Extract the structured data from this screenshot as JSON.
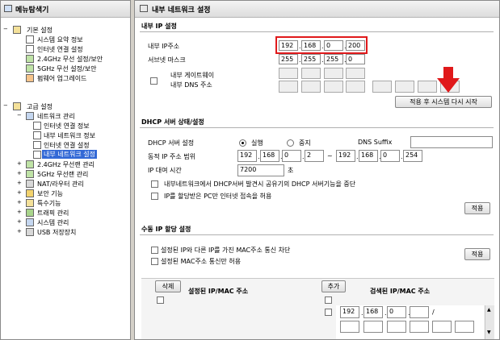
{
  "sidebar": {
    "title": "메뉴탐색기",
    "basic_group": "기본 설정",
    "basic_items": [
      "시스템 요약 정보",
      "인터넷 연결 설정",
      "2.4GHz 무선 설정/보안",
      "5GHz 무선 설정/보안",
      "펌웨어 업그레이드"
    ],
    "advanced_group": "고급 설정",
    "network_mgmt": "네트워크 관리",
    "network_items": [
      "인터넷 연결 정보",
      "내부 네트워크 정보",
      "인터넷 연결 설정",
      "내부 네트워크 설정"
    ],
    "advanced_items": [
      "2.4GHz 무선랜 관리",
      "5GHz 무선랜 관리",
      "NAT/라우터 관리",
      "보안 기능",
      "특수기능",
      "트래픽 관리",
      "시스템 관리",
      "USB 저장장치"
    ]
  },
  "main": {
    "title": "내부 네트워크 설정",
    "internal_ip_section": "내부 IP 설정",
    "internal_ip_label": "내부 IP주소",
    "internal_ip": [
      "192",
      "168",
      "0",
      "200"
    ],
    "subnet_label": "서브넷 마스크",
    "subnet": [
      "255",
      "255",
      "255",
      "0"
    ],
    "gateway_label": "내부 게이트웨이",
    "dns_label": "내부 DNS 주소",
    "apply_restart_button": "적용 후 시스템 다시 시작",
    "dhcp_section": "DHCP 서버 상태/설정",
    "dhcp_server_label": "DHCP 서버 설정",
    "dhcp_run_label": "실행",
    "dhcp_stop_label": "중지",
    "dns_suffix_label": "DNS Suffix",
    "dynamic_ip_range_label": "동적 IP 주소 범위",
    "range_start": [
      "192",
      "168",
      "0",
      "2"
    ],
    "range_tilde": "~",
    "range_end": [
      "192",
      "168",
      "0",
      "254"
    ],
    "lease_time_label": "IP 대여 시간",
    "lease_time_value": "7200",
    "lease_unit": "초",
    "dhcp_option1": "내부네트워크에서 DHCP서버 발견시 공유기의 DHCP 서버기능을 중단",
    "dhcp_option2": "IP를 할당받은 PC만 인터넷 접속을 허용",
    "apply_button": "적용",
    "manual_section": "수동 IP 할당 설정",
    "manual_option1": "설정된 IP와 다른 IP를 가진 MAC주소 통신 차단",
    "manual_option2": "설정된 MAC주소 통신만 허용",
    "apply_button2": "적용",
    "delete_button": "삭제",
    "configured_header": "설정된 IP/MAC 주소",
    "add_button": "추가",
    "searched_header": "검색된 IP/MAC 주소",
    "search_ip": [
      "192",
      "168",
      "0",
      ""
    ],
    "slash": "/",
    "dot": "."
  },
  "colors": {
    "highlight_border": "#e0191b",
    "arrow": "#e0191b",
    "selected_item_bg": "#3369d6"
  }
}
